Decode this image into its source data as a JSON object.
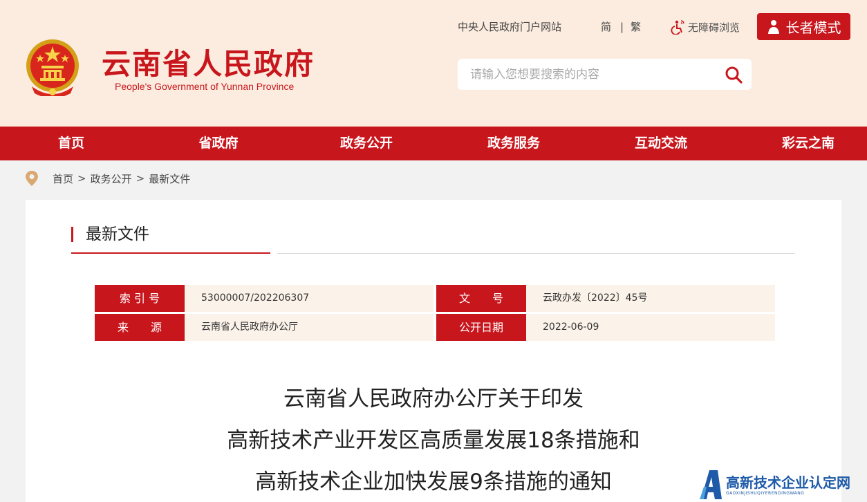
{
  "header": {
    "site_title": "云南省人民政府",
    "site_subtitle": "People's Government of Yunnan Province",
    "central_gov_link": "中央人民政府门户网站",
    "lang_simplified": "简",
    "lang_separator": "|",
    "lang_traditional": "繁",
    "accessibility_label": "无障碍浏览",
    "elder_mode_label": "长者模式",
    "search_placeholder": "请输入您想要搜索的内容"
  },
  "nav": {
    "items": [
      "首页",
      "省政府",
      "政务公开",
      "政务服务",
      "互动交流",
      "彩云之南"
    ]
  },
  "breadcrumb": {
    "items": [
      "首页",
      "政务公开",
      "最新文件"
    ],
    "separator": ">"
  },
  "section": {
    "title": "最新文件"
  },
  "meta": {
    "index_label": "索 引 号",
    "index_value": "53000007/202206307",
    "docno_label": "文　　号",
    "docno_value": "云政办发〔2022〕45号",
    "source_label": "来　　源",
    "source_value": "云南省人民政府办公厅",
    "date_label": "公开日期",
    "date_value": "2022-06-09"
  },
  "document": {
    "title_lines": [
      "云南省人民政府办公厅关于印发",
      "高新技术产业开发区高质量发展18条措施和",
      "高新技术企业加快发展9条措施的通知"
    ]
  },
  "watermark": {
    "main": "高新技术企业认定网",
    "sub": "GAOXINJISHUQIYERENDINGWANG"
  },
  "colors": {
    "brand_red": "#c8161d",
    "header_bg": "#fcecdf",
    "meta_value_bg": "#fbf2e9",
    "watermark_blue": "#1e5aa8"
  }
}
